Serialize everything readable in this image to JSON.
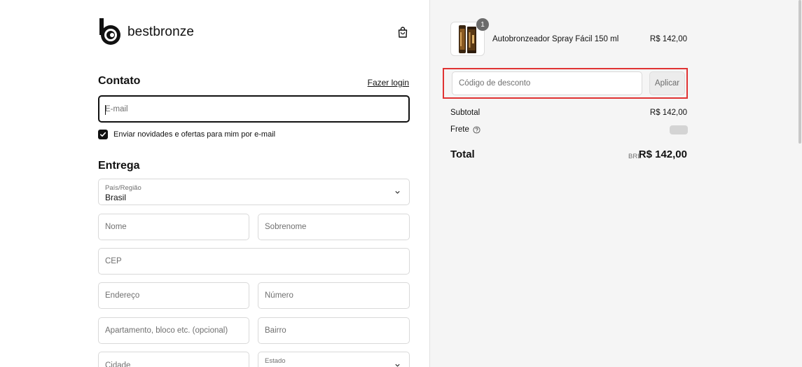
{
  "brand": {
    "name": "bestbronze",
    "logo_icon": "bestbronze-logo-icon",
    "bag_icon": "shopping-bag-icon"
  },
  "contact": {
    "title": "Contato",
    "login_link": "Fazer login",
    "email_placeholder": "E-mail",
    "newsletter_label": "Enviar novidades e ofertas para mim por e-mail",
    "newsletter_checked": true
  },
  "delivery": {
    "title": "Entrega",
    "country_label": "País/Região",
    "country_value": "Brasil",
    "first_name_placeholder": "Nome",
    "last_name_placeholder": "Sobrenome",
    "cep_placeholder": "CEP",
    "address_placeholder": "Endereço",
    "number_placeholder": "Número",
    "apartment_placeholder": "Apartamento, bloco etc. (opcional)",
    "neighborhood_placeholder": "Bairro",
    "city_placeholder": "Cidade",
    "state_label": "Estado"
  },
  "order": {
    "quantity": "1",
    "product_name": "Autobronzeador Spray Fácil 150 ml",
    "product_price": "R$ 142,00",
    "discount_placeholder": "Código de desconto",
    "apply_label": "Aplicar",
    "subtotal_label": "Subtotal",
    "subtotal_value": "R$ 142,00",
    "shipping_label": "Frete",
    "total_label": "Total",
    "total_currency": "BRL",
    "total_value": "R$ 142,00"
  },
  "colors": {
    "highlight": "#e03333",
    "summary_bg": "#f5f5f5",
    "text": "#111111"
  }
}
